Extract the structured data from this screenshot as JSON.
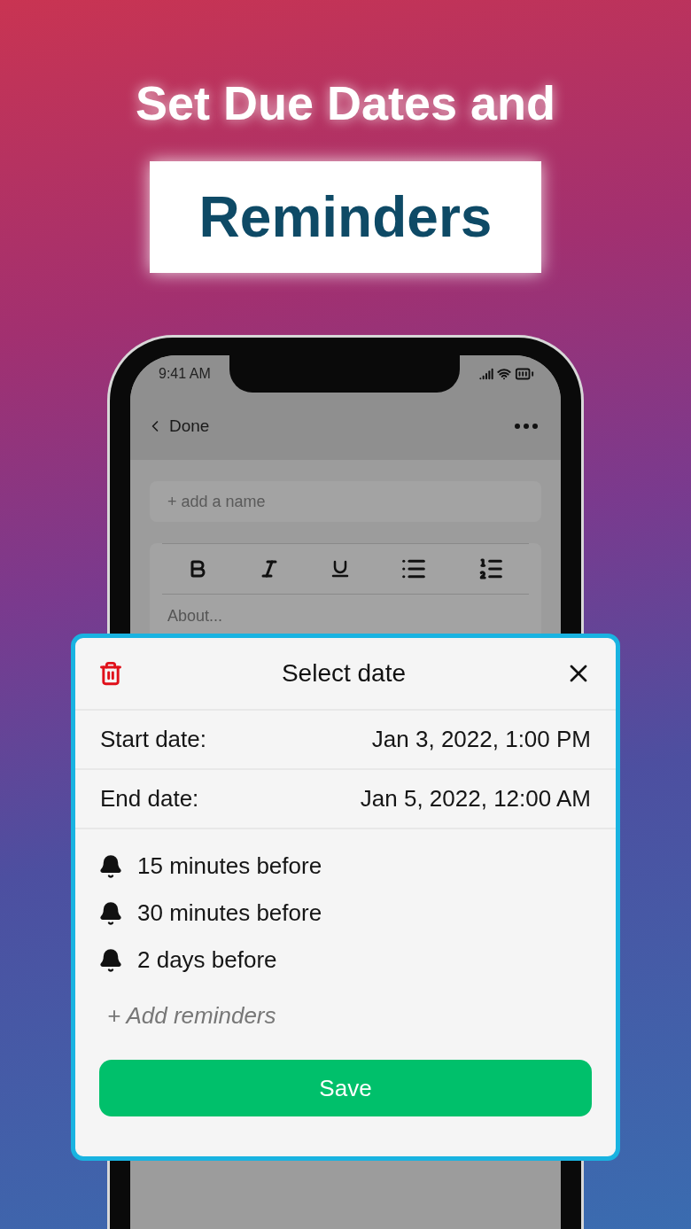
{
  "headline": "Set Due Dates and",
  "headline_box": "Reminders",
  "phone": {
    "status_bar": {
      "time": "9:41 AM"
    },
    "nav": {
      "back": "Done"
    },
    "name_field": {
      "placeholder": "+ add a name"
    },
    "toolbar": [
      {
        "kind": "bold"
      },
      {
        "kind": "italic"
      },
      {
        "kind": "underline"
      },
      {
        "kind": "bullets"
      },
      {
        "kind": "numbers"
      }
    ],
    "notes_field": {
      "placeholder": "About..."
    }
  },
  "dialog": {
    "title": "Select date",
    "rows": [
      {
        "label": "Start date:",
        "value": "Jan 3, 2022, 1:00 PM"
      },
      {
        "label": "End date:",
        "value": "Jan 5, 2022, 12:00 AM"
      }
    ],
    "reminders": [
      "15 minutes before",
      "30 minutes before",
      "2 days before"
    ],
    "add_reminder": "+ Add reminders",
    "save": "Save"
  }
}
